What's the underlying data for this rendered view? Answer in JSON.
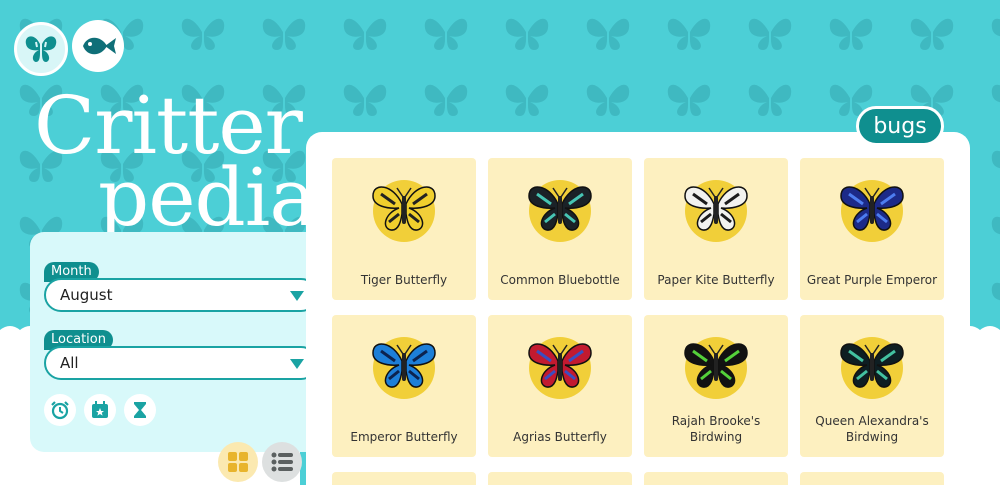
{
  "app": {
    "title_line1": "Critter",
    "title_line2": "pedia"
  },
  "mode_buttons": [
    {
      "name": "bugs",
      "icon": "butterfly-icon"
    },
    {
      "name": "fish",
      "icon": "fish-icon"
    }
  ],
  "filters": {
    "month": {
      "label": "Month",
      "value": "August"
    },
    "location": {
      "label": "Location",
      "value": "All"
    },
    "chips": [
      {
        "icon": "alarm-clock-icon"
      },
      {
        "icon": "calendar-star-icon"
      },
      {
        "icon": "hourglass-icon"
      }
    ]
  },
  "view_toggle": {
    "grid_icon": "grid-icon",
    "list_icon": "list-icon",
    "active": "grid"
  },
  "section_tag": "bugs",
  "critters": [
    {
      "name": "Tiger Butterfly",
      "wing": "#f0cf2d",
      "mark": "#222"
    },
    {
      "name": "Common Bluebottle",
      "wing": "#1b2227",
      "mark": "#47c5b4"
    },
    {
      "name": "Paper Kite Butterfly",
      "wing": "#f2f2ef",
      "mark": "#1c1c1c"
    },
    {
      "name": "Great Purple Emperor",
      "wing": "#1c2a88",
      "mark": "#4d7df0"
    },
    {
      "name": "Emperor Butterfly",
      "wing": "#1d7fd8",
      "mark": "#0c234f"
    },
    {
      "name": "Agrias Butterfly",
      "wing": "#c21a30",
      "mark": "#3a4ec1"
    },
    {
      "name": "Rajah Brooke's Birdwing",
      "wing": "#121212",
      "mark": "#54d13a"
    },
    {
      "name": "Queen Alexandra's Birdwing",
      "wing": "#0e1e22",
      "mark": "#43c1a0"
    }
  ],
  "colors": {
    "sky": "#4ccfd6",
    "teal": "#0f8f8f",
    "card": "#fdf0c0",
    "disc": "#f1cf39"
  }
}
